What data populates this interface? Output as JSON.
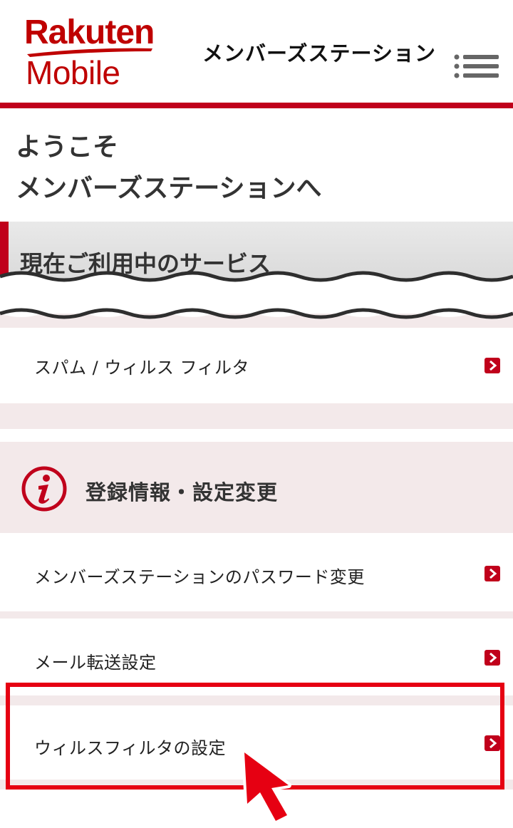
{
  "header": {
    "logo_line1": "Rakuten",
    "logo_line2": "Mobile",
    "title": "メンバーズステーション",
    "menu_icon": "hamburger-menu-icon"
  },
  "welcome": {
    "line1": "ようこそ",
    "line2": "メンバーズステーションへ"
  },
  "services": {
    "title": "現在ご利用中のサービス",
    "items": [
      {
        "label": "スパム / ウィルス フィルタ"
      }
    ]
  },
  "registration": {
    "title": "登録情報・設定変更",
    "icon": "info-icon",
    "items": [
      {
        "label": "メンバーズステーションのパスワード変更"
      },
      {
        "label": "メール転送設定"
      },
      {
        "label": "ウィルスフィルタの設定"
      }
    ]
  },
  "colors": {
    "brand_red": "#bf0000",
    "highlight_red": "#e60012",
    "band_pink": "#f3e9ea"
  }
}
